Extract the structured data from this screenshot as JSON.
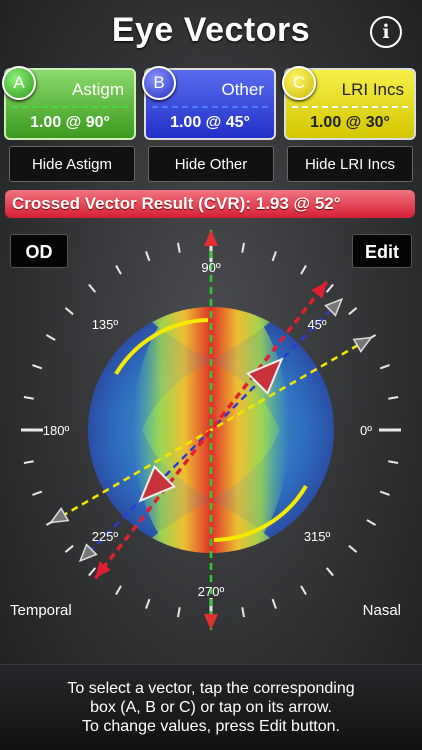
{
  "header": {
    "title": "Eye Vectors"
  },
  "vectors": [
    {
      "letter": "A",
      "name": "Astigm",
      "value": "1.00 @ 90°"
    },
    {
      "letter": "B",
      "name": "Other",
      "value": "1.00 @ 45°"
    },
    {
      "letter": "C",
      "name": "LRI Incs",
      "value": "1.00 @ 30°"
    }
  ],
  "hide_buttons": [
    "Hide Astigm",
    "Hide Other",
    "Hide LRI Incs"
  ],
  "result": {
    "label": "Crossed Vector Result (CVR):",
    "value": "1.93 @ 52°"
  },
  "eye_button": "OD",
  "edit_button": "Edit",
  "dial": {
    "angle_labels": [
      "90º",
      "45º",
      "0º",
      "315º",
      "270º",
      "225º",
      "180º",
      "135º"
    ],
    "temporal": "Temporal",
    "nasal": "Nasal"
  },
  "instructions": [
    "To select a vector, tap the corresponding",
    "box (A, B or C) or tap on its arrow.",
    "To change values, press Edit button."
  ],
  "colors": {
    "astigm": "#2ecc2e",
    "other": "#2a3bd6",
    "lri": "#f2e600",
    "result": "#e0202f"
  }
}
